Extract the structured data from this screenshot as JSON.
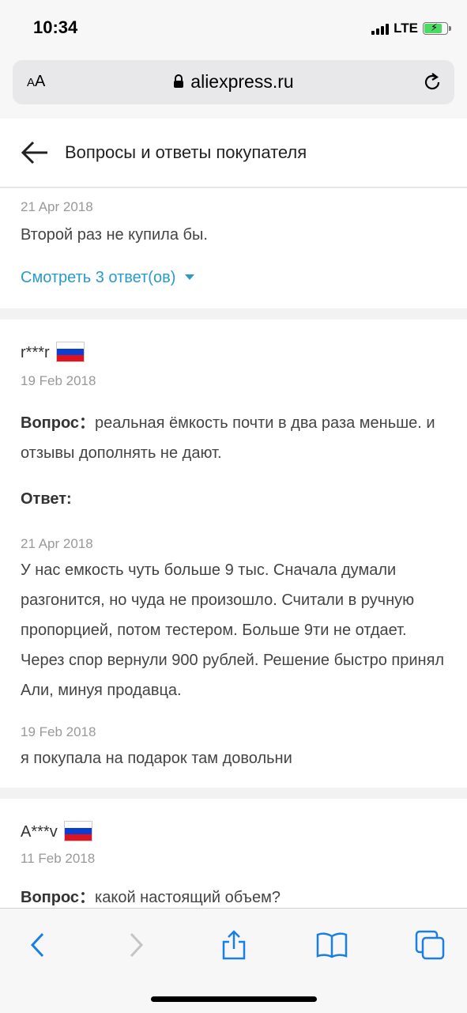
{
  "status_bar": {
    "time": "10:34",
    "network": "LTE"
  },
  "browser": {
    "text_size_label_small": "A",
    "text_size_label_big": "A",
    "url": "aliexpress.ru"
  },
  "header": {
    "title": "Вопросы и ответы покупателя"
  },
  "items": [
    {
      "date": "21 Apr 2018",
      "text": "Второй раз не купила бы.",
      "link": "Смотреть 3 ответ(ов)"
    },
    {
      "user": "r***r",
      "country_flag": "russia-flag",
      "date": "19 Feb 2018",
      "question_label": "Вопрос：",
      "question_text": "реальная ёмкость почти в два раза меньше. и отзывы дополнять не дают.",
      "answer_label": "Ответ:",
      "answers": [
        {
          "date": "21 Apr 2018",
          "text": "У нас емкость чуть больше 9 тыс. Сначала думали разгонится, но чуда не произошло. Считали в ручную пропорцией, потом тестером. Больше 9ти не отдает. Через спор вернули 900 рублей. Решение быстро принял Али, минуя продавца."
        },
        {
          "date": "19 Feb 2018",
          "text": "я покупала на подарок там довольни"
        }
      ]
    },
    {
      "user": "A***v",
      "country_flag": "russia-flag",
      "date": "11 Feb 2018",
      "question_label": "Вопрос：",
      "question_text": "какой настоящий объем?"
    }
  ],
  "colors": {
    "link": "#2a9ac9",
    "accent": "#1a7fe5",
    "flag_white": "#ffffff",
    "flag_blue": "#0b3fd1",
    "flag_red": "#e0121d"
  },
  "toolbar": {
    "icons": [
      "back-icon",
      "forward-icon",
      "share-icon",
      "bookmarks-icon",
      "tabs-icon"
    ]
  }
}
